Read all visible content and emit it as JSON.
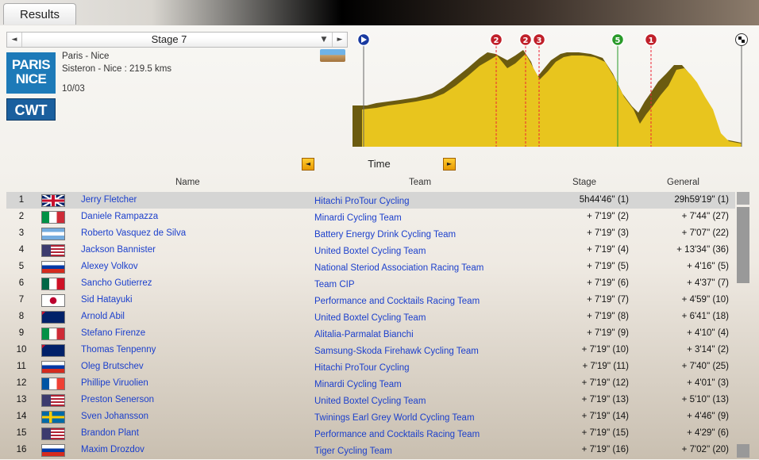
{
  "tab_label": "Results",
  "stage_selector": {
    "value": "Stage 7",
    "prev": "◄",
    "next": "►",
    "dropdown": "▼"
  },
  "race": {
    "logo_line1": "PARIS",
    "logo_line2": "NICE",
    "name": "Paris - Nice",
    "route": "Sisteron - Nice : 219.5 kms",
    "date": "10/03",
    "category": "CWT"
  },
  "profile_markers": [
    "2",
    "2",
    "3",
    "5",
    "1"
  ],
  "profile_colors": {
    "fill": "#e8c51e",
    "shadow": "#6b5b10",
    "climb_marker": "#c0202a",
    "sprint_marker": "#2a9a2a",
    "start_marker": "#1a3aa0"
  },
  "time_selector": {
    "label": "Time"
  },
  "columns": {
    "name": "Name",
    "team": "Team",
    "stage": "Stage",
    "general": "General"
  },
  "rows": [
    {
      "pos": "1",
      "country": "gb",
      "name": "Jerry Fletcher",
      "team": "Hitachi ProTour Cycling",
      "stage": "5h44'46'' (1)",
      "general": "29h59'19'' (1)"
    },
    {
      "pos": "2",
      "country": "it",
      "name": "Daniele Rampazza",
      "team": "Minardi Cycling Team",
      "stage": "+ 7'19'' (2)",
      "general": "+ 7'44'' (27)"
    },
    {
      "pos": "3",
      "country": "ar",
      "name": "Roberto Vasquez de Silva",
      "team": "Battery Energy Drink Cycling Team",
      "stage": "+ 7'19'' (3)",
      "general": "+ 7'07'' (22)"
    },
    {
      "pos": "4",
      "country": "us",
      "name": "Jackson Bannister",
      "team": "United Boxtel Cycling Team",
      "stage": "+ 7'19'' (4)",
      "general": "+ 13'34'' (36)"
    },
    {
      "pos": "5",
      "country": "ru",
      "name": "Alexey Volkov",
      "team": "National Steriod Association Racing Team",
      "stage": "+ 7'19'' (5)",
      "general": "+ 4'16'' (5)"
    },
    {
      "pos": "6",
      "country": "mx",
      "name": "Sancho Gutierrez",
      "team": "Team CIP",
      "stage": "+ 7'19'' (6)",
      "general": "+ 4'37'' (7)"
    },
    {
      "pos": "7",
      "country": "jp",
      "name": "Sid Hatayuki",
      "team": "Performance and Cocktails Racing Team",
      "stage": "+ 7'19'' (7)",
      "general": "+ 4'59'' (10)"
    },
    {
      "pos": "8",
      "country": "nz",
      "name": "Arnold Abil",
      "team": "United Boxtel Cycling Team",
      "stage": "+ 7'19'' (8)",
      "general": "+ 6'41'' (18)"
    },
    {
      "pos": "9",
      "country": "it",
      "name": "Stefano Firenze",
      "team": "Alitalia-Parmalat Bianchi",
      "stage": "+ 7'19'' (9)",
      "general": "+ 4'10'' (4)"
    },
    {
      "pos": "10",
      "country": "nz",
      "name": "Thomas Tenpenny",
      "team": "Samsung-Skoda Firehawk Cycling Team",
      "stage": "+ 7'19'' (10)",
      "general": "+ 3'14'' (2)"
    },
    {
      "pos": "11",
      "country": "ru",
      "name": "Oleg Brutschev",
      "team": "Hitachi ProTour Cycling",
      "stage": "+ 7'19'' (11)",
      "general": "+ 7'40'' (25)"
    },
    {
      "pos": "12",
      "country": "fr",
      "name": "Phillipe Viruolien",
      "team": "Minardi Cycling Team",
      "stage": "+ 7'19'' (12)",
      "general": "+ 4'01'' (3)"
    },
    {
      "pos": "13",
      "country": "us",
      "name": "Preston Senerson",
      "team": "United Boxtel Cycling Team",
      "stage": "+ 7'19'' (13)",
      "general": "+ 5'10'' (13)"
    },
    {
      "pos": "14",
      "country": "se",
      "name": "Sven Johansson",
      "team": "Twinings Earl Grey World Cycling Team",
      "stage": "+ 7'19'' (14)",
      "general": "+ 4'46'' (9)"
    },
    {
      "pos": "15",
      "country": "us",
      "name": "Brandon Plant",
      "team": "Performance and Cocktails Racing Team",
      "stage": "+ 7'19'' (15)",
      "general": "+ 4'29'' (6)"
    },
    {
      "pos": "16",
      "country": "ru",
      "name": "Maxim Drozdov",
      "team": "Tiger Cycling Team",
      "stage": "+ 7'19'' (16)",
      "general": "+ 7'02'' (20)"
    }
  ]
}
